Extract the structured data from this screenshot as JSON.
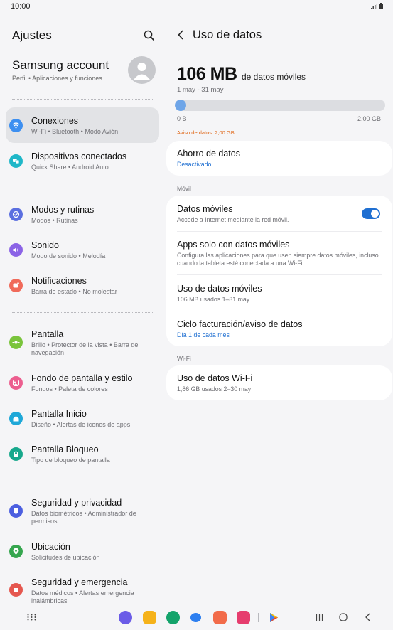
{
  "status": {
    "time": "10:00"
  },
  "left": {
    "title": "Ajustes",
    "account": {
      "title": "Samsung account",
      "subtitle": "Perfil  •  Aplicaciones y funciones"
    },
    "items": [
      {
        "label": "Conexiones",
        "sub": "Wi-Fi  •  Bluetooth  •  Modo Avión",
        "icon": "wifi-icon",
        "color": "#3d8ff0"
      },
      {
        "label": "Dispositivos conectados",
        "sub": "Quick Share  •  Android Auto",
        "icon": "devices-icon",
        "color": "#1fb7c8"
      },
      {
        "label": "Modos y rutinas",
        "sub": "Modos  •  Rutinas",
        "icon": "check-circle-icon",
        "color": "#5b6fe0"
      },
      {
        "label": "Sonido",
        "sub": "Modo de sonido  •  Melodía",
        "icon": "volume-icon",
        "color": "#8b63e6"
      },
      {
        "label": "Notificaciones",
        "sub": "Barra de estado  •  No molestar",
        "icon": "notification-icon",
        "color": "#f06a5a"
      },
      {
        "label": "Pantalla",
        "sub": "Brillo  •  Protector de la vista  •  Barra de navegación",
        "icon": "sun-icon",
        "color": "#7ac43c"
      },
      {
        "label": "Fondo de pantalla y estilo",
        "sub": "Fondos  •  Paleta de colores",
        "icon": "palette-icon",
        "color": "#ec5e8f"
      },
      {
        "label": "Pantalla Inicio",
        "sub": "Diseño  •  Alertas de iconos de apps",
        "icon": "home-icon",
        "color": "#1fa8d8"
      },
      {
        "label": "Pantalla Bloqueo",
        "sub": "Tipo de bloqueo de pantalla",
        "icon": "lock-icon",
        "color": "#17a88c"
      },
      {
        "label": "Seguridad y privacidad",
        "sub": "Datos biométricos  •  Administrador de permisos",
        "icon": "shield-icon",
        "color": "#4c5fe0"
      },
      {
        "label": "Ubicación",
        "sub": "Solicitudes de ubicación",
        "icon": "location-icon",
        "color": "#36a64f"
      },
      {
        "label": "Seguridad y emergencia",
        "sub": "Datos médicos  •  Alertas emergencia inalámbricas",
        "icon": "emergency-icon",
        "color": "#e5574f"
      }
    ]
  },
  "right": {
    "title": "Uso de datos",
    "usage": {
      "amount": "106 MB",
      "unit": "de datos móviles",
      "period": "1 may - 31 may",
      "bar_min": "0 B",
      "bar_max": "2,00 GB",
      "fill_fraction": 0.053,
      "warning": "Aviso de datos: 2,00 GB"
    },
    "saver": {
      "title": "Ahorro de datos",
      "sub": "Desactivado"
    },
    "mobile_section": "Móvil",
    "mobile": {
      "data": {
        "title": "Datos móviles",
        "sub": "Accede a Internet mediante la red móvil.",
        "enabled": true
      },
      "apps": {
        "title": "Apps solo con datos móviles",
        "sub": "Configura las aplicaciones para que usen siempre datos móviles, incluso cuando la tableta esté conectada a una Wi-Fi."
      },
      "usage": {
        "title": "Uso de datos móviles",
        "sub": "106 MB usados 1–31 may"
      },
      "cycle": {
        "title": "Ciclo facturación/aviso de datos",
        "sub": "Día 1 de cada mes"
      }
    },
    "wifi_section": "Wi-Fi",
    "wifi": {
      "title": "Uso de datos Wi-Fi",
      "sub": "1,86 GB usados 2–30 may"
    }
  },
  "colors": {
    "accent": "#1f6fd1",
    "warning": "#e06b1e",
    "active_bg": "#e2e3e6"
  }
}
